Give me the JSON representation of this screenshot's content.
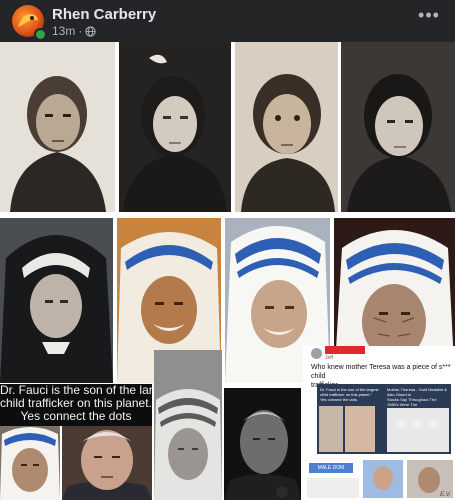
{
  "post": {
    "author_name": "Rhen Carberry",
    "timestamp": "13m",
    "separator": "·",
    "more_label": "•••"
  },
  "collage": {
    "caption_lines": [
      "Dr. Fauci is the son of the largest",
      "child trafficker on this planet.\"",
      "Yes connect the dots"
    ],
    "inner_card": {
      "author_suffix": "Jeff",
      "text_lines": [
        "Who knew mother Teresa was a piece of s*** child",
        "trafficker"
      ],
      "inner_caption": [
        "Dr. Fauci is the son of the largest",
        "child trafficker on this planet.\"",
        "Yes connect the dots"
      ],
      "side_caption": [
        "Mother Theresa - Gold Medalist & Also Glued to",
        "Stocks Say Throughout The 1980's Were The",
        "Most Trafficked Women in Sport"
      ],
      "badge": "MALE DOM",
      "watermark": "E.V."
    }
  },
  "colors": {
    "page_bg": "#18191a",
    "header_bg": "#242526",
    "name_text": "#e4e6eb",
    "meta_text": "#b0b3b8",
    "online_green": "#31a24c",
    "caption_bg": "#0d0d0d",
    "habit_blue": "#2f5fb5"
  },
  "icons": [
    "globe-icon",
    "more-options-icon"
  ]
}
